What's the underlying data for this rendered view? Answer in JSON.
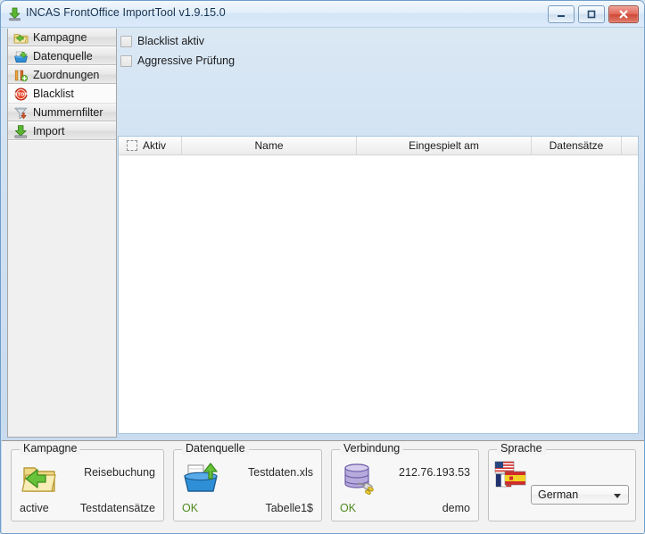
{
  "window": {
    "title": "INCAS FrontOffice ImportTool v1.9.15.0",
    "title_icon": "import-arrow-icon",
    "minimize_label": "–",
    "maximize_label": "▫",
    "close_label": "✕",
    "accent_blue": "#6f9ec9",
    "close_red": "#cf4a38"
  },
  "sidebar": {
    "items": [
      {
        "label": "Kampagne",
        "icon": "folder-arrow-icon",
        "selected": false
      },
      {
        "label": "Datenquelle",
        "icon": "data-bucket-icon",
        "selected": false
      },
      {
        "label": "Zuordnungen",
        "icon": "columns-plus-icon",
        "selected": false
      },
      {
        "label": "Blacklist",
        "icon": "stop-sign-icon",
        "selected": true
      },
      {
        "label": "Nummernfilter",
        "icon": "funnel-arrow-icon",
        "selected": false
      },
      {
        "label": "Import",
        "icon": "import-arrow-icon",
        "selected": false
      }
    ]
  },
  "content": {
    "checkboxes": [
      {
        "label": "Blacklist aktiv",
        "checked": false
      },
      {
        "label": "Aggressive Prüfung",
        "checked": false
      }
    ],
    "grid": {
      "columns": [
        {
          "label": "Aktiv",
          "icon": "checkbox-header-icon"
        },
        {
          "label": "Name",
          "icon": ""
        },
        {
          "label": "Eingespielt am",
          "icon": ""
        },
        {
          "label": "Datensätze",
          "icon": ""
        }
      ],
      "rows": []
    }
  },
  "status": {
    "kampagne": {
      "title": "Kampagne",
      "icon": "folder-arrow-icon",
      "top_right": "Reisebuchung",
      "bottom_left": "active",
      "bottom_right": "Testdatensätze"
    },
    "datenquelle": {
      "title": "Datenquelle",
      "icon": "data-bucket-icon",
      "top_right": "Testdaten.xls",
      "bottom_left": "OK",
      "bottom_right": "Tabelle1$"
    },
    "verbindung": {
      "title": "Verbindung",
      "icon": "database-plug-icon",
      "top_right": "212.76.193.53",
      "bottom_left": "OK",
      "bottom_right": "demo"
    },
    "sprache": {
      "title": "Sprache",
      "icon": "flags-icon",
      "selected_language": "German",
      "options": [
        "German"
      ]
    },
    "ok_color": "#4f8a22"
  }
}
